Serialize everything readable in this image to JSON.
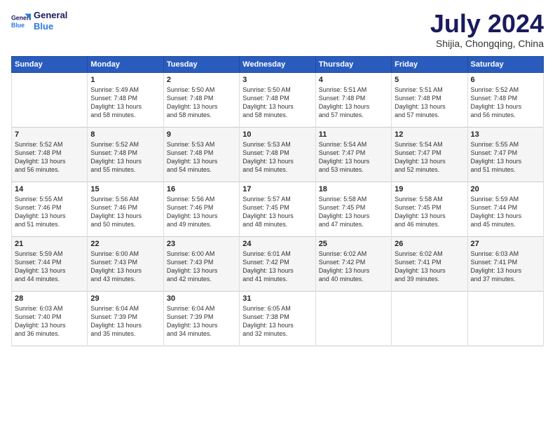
{
  "logo": {
    "line1": "General",
    "line2": "Blue"
  },
  "title": "July 2024",
  "subtitle": "Shijia, Chongqing, China",
  "weekdays": [
    "Sunday",
    "Monday",
    "Tuesday",
    "Wednesday",
    "Thursday",
    "Friday",
    "Saturday"
  ],
  "weeks": [
    [
      {
        "day": "",
        "info": ""
      },
      {
        "day": "1",
        "info": "Sunrise: 5:49 AM\nSunset: 7:48 PM\nDaylight: 13 hours\nand 58 minutes."
      },
      {
        "day": "2",
        "info": "Sunrise: 5:50 AM\nSunset: 7:48 PM\nDaylight: 13 hours\nand 58 minutes."
      },
      {
        "day": "3",
        "info": "Sunrise: 5:50 AM\nSunset: 7:48 PM\nDaylight: 13 hours\nand 58 minutes."
      },
      {
        "day": "4",
        "info": "Sunrise: 5:51 AM\nSunset: 7:48 PM\nDaylight: 13 hours\nand 57 minutes."
      },
      {
        "day": "5",
        "info": "Sunrise: 5:51 AM\nSunset: 7:48 PM\nDaylight: 13 hours\nand 57 minutes."
      },
      {
        "day": "6",
        "info": "Sunrise: 5:52 AM\nSunset: 7:48 PM\nDaylight: 13 hours\nand 56 minutes."
      }
    ],
    [
      {
        "day": "7",
        "info": "Sunrise: 5:52 AM\nSunset: 7:48 PM\nDaylight: 13 hours\nand 56 minutes."
      },
      {
        "day": "8",
        "info": "Sunrise: 5:52 AM\nSunset: 7:48 PM\nDaylight: 13 hours\nand 55 minutes."
      },
      {
        "day": "9",
        "info": "Sunrise: 5:53 AM\nSunset: 7:48 PM\nDaylight: 13 hours\nand 54 minutes."
      },
      {
        "day": "10",
        "info": "Sunrise: 5:53 AM\nSunset: 7:48 PM\nDaylight: 13 hours\nand 54 minutes."
      },
      {
        "day": "11",
        "info": "Sunrise: 5:54 AM\nSunset: 7:47 PM\nDaylight: 13 hours\nand 53 minutes."
      },
      {
        "day": "12",
        "info": "Sunrise: 5:54 AM\nSunset: 7:47 PM\nDaylight: 13 hours\nand 52 minutes."
      },
      {
        "day": "13",
        "info": "Sunrise: 5:55 AM\nSunset: 7:47 PM\nDaylight: 13 hours\nand 51 minutes."
      }
    ],
    [
      {
        "day": "14",
        "info": "Sunrise: 5:55 AM\nSunset: 7:46 PM\nDaylight: 13 hours\nand 51 minutes."
      },
      {
        "day": "15",
        "info": "Sunrise: 5:56 AM\nSunset: 7:46 PM\nDaylight: 13 hours\nand 50 minutes."
      },
      {
        "day": "16",
        "info": "Sunrise: 5:56 AM\nSunset: 7:46 PM\nDaylight: 13 hours\nand 49 minutes."
      },
      {
        "day": "17",
        "info": "Sunrise: 5:57 AM\nSunset: 7:45 PM\nDaylight: 13 hours\nand 48 minutes."
      },
      {
        "day": "18",
        "info": "Sunrise: 5:58 AM\nSunset: 7:45 PM\nDaylight: 13 hours\nand 47 minutes."
      },
      {
        "day": "19",
        "info": "Sunrise: 5:58 AM\nSunset: 7:45 PM\nDaylight: 13 hours\nand 46 minutes."
      },
      {
        "day": "20",
        "info": "Sunrise: 5:59 AM\nSunset: 7:44 PM\nDaylight: 13 hours\nand 45 minutes."
      }
    ],
    [
      {
        "day": "21",
        "info": "Sunrise: 5:59 AM\nSunset: 7:44 PM\nDaylight: 13 hours\nand 44 minutes."
      },
      {
        "day": "22",
        "info": "Sunrise: 6:00 AM\nSunset: 7:43 PM\nDaylight: 13 hours\nand 43 minutes."
      },
      {
        "day": "23",
        "info": "Sunrise: 6:00 AM\nSunset: 7:43 PM\nDaylight: 13 hours\nand 42 minutes."
      },
      {
        "day": "24",
        "info": "Sunrise: 6:01 AM\nSunset: 7:42 PM\nDaylight: 13 hours\nand 41 minutes."
      },
      {
        "day": "25",
        "info": "Sunrise: 6:02 AM\nSunset: 7:42 PM\nDaylight: 13 hours\nand 40 minutes."
      },
      {
        "day": "26",
        "info": "Sunrise: 6:02 AM\nSunset: 7:41 PM\nDaylight: 13 hours\nand 39 minutes."
      },
      {
        "day": "27",
        "info": "Sunrise: 6:03 AM\nSunset: 7:41 PM\nDaylight: 13 hours\nand 37 minutes."
      }
    ],
    [
      {
        "day": "28",
        "info": "Sunrise: 6:03 AM\nSunset: 7:40 PM\nDaylight: 13 hours\nand 36 minutes."
      },
      {
        "day": "29",
        "info": "Sunrise: 6:04 AM\nSunset: 7:39 PM\nDaylight: 13 hours\nand 35 minutes."
      },
      {
        "day": "30",
        "info": "Sunrise: 6:04 AM\nSunset: 7:39 PM\nDaylight: 13 hours\nand 34 minutes."
      },
      {
        "day": "31",
        "info": "Sunrise: 6:05 AM\nSunset: 7:38 PM\nDaylight: 13 hours\nand 32 minutes."
      },
      {
        "day": "",
        "info": ""
      },
      {
        "day": "",
        "info": ""
      },
      {
        "day": "",
        "info": ""
      }
    ]
  ]
}
